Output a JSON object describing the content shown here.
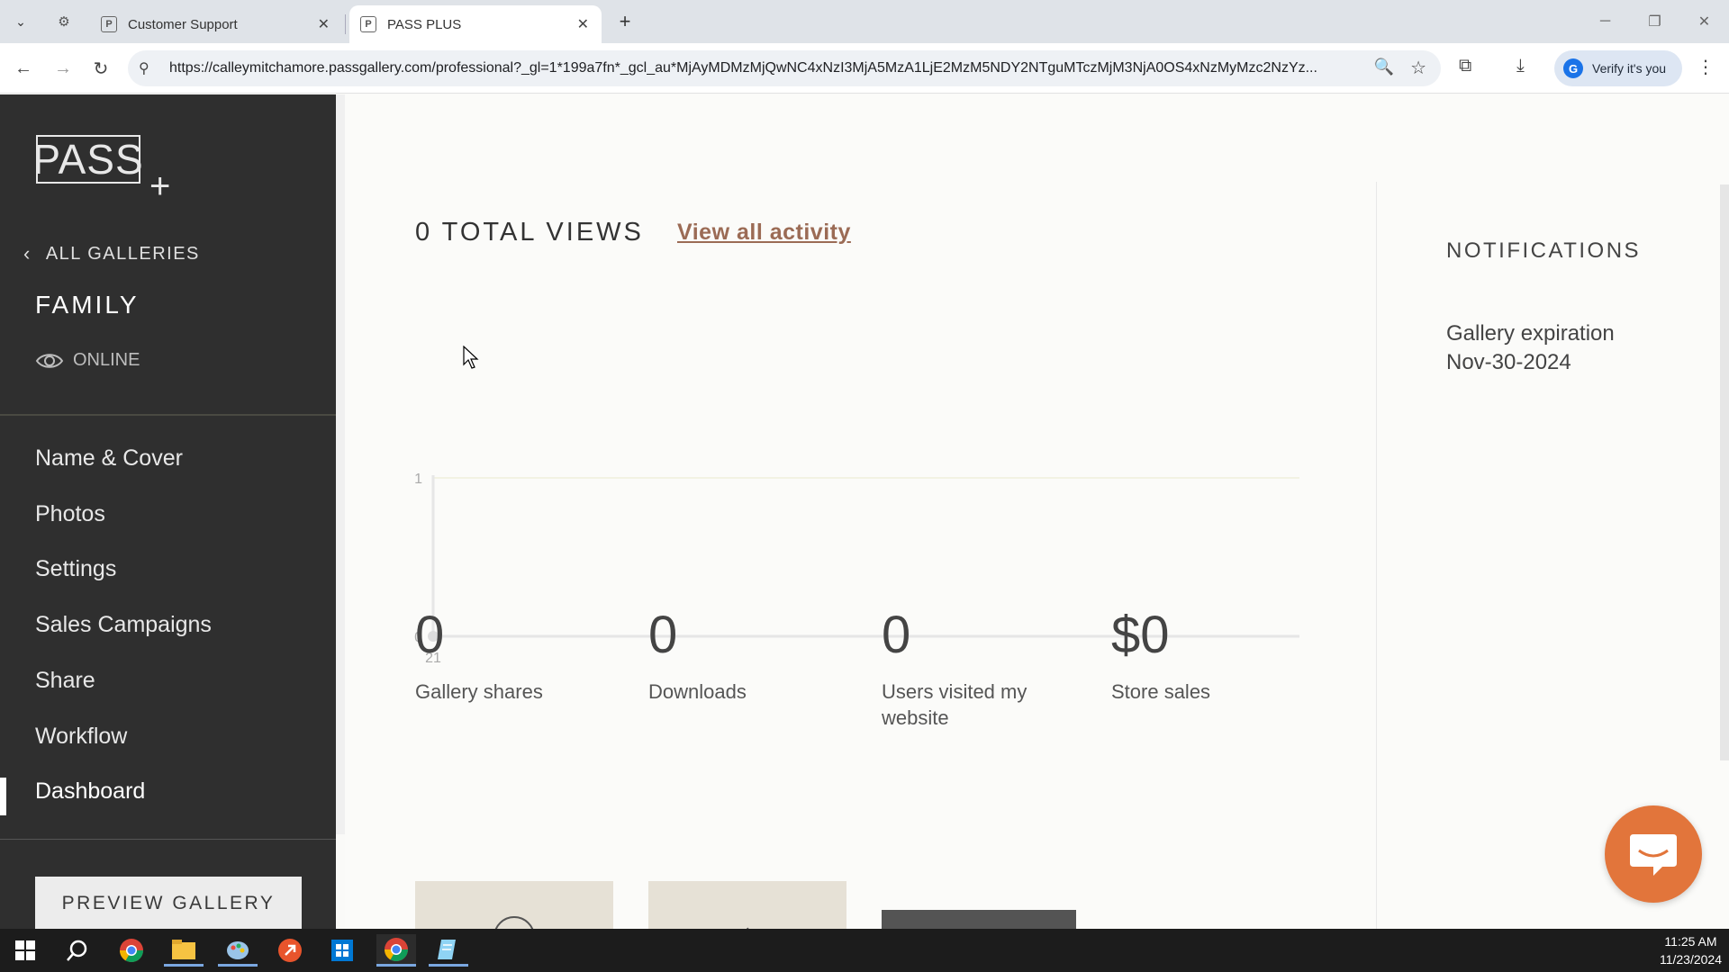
{
  "browser": {
    "tabs": [
      {
        "label": "Customer Support",
        "favicon": "P"
      },
      {
        "label": "PASS PLUS",
        "favicon": "P"
      }
    ],
    "url": "https://calleymitchamore.passgallery.com/professional?_gl=1*199a7fn*_gcl_au*MjAyMDMzMjQwNC4xNzI3MjA5MzA1LjE2MzM5NDY2NTguMTczMjM3NjA0OS4xNzMyMzc2NzYz...",
    "profile_label": "Verify it's you"
  },
  "sidebar": {
    "logo": "PASS",
    "logo_plus": "+",
    "back_label": "ALL GALLERIES",
    "gallery_name": "FAMILY",
    "status": "ONLINE",
    "nav": [
      {
        "label": "Name & Cover"
      },
      {
        "label": "Photos"
      },
      {
        "label": "Settings"
      },
      {
        "label": "Sales Campaigns"
      },
      {
        "label": "Share"
      },
      {
        "label": "Workflow"
      },
      {
        "label": "Dashboard",
        "active": true
      }
    ],
    "preview_button": "PREVIEW GALLERY"
  },
  "main": {
    "total_views": "0 TOTAL VIEWS",
    "view_all_activity": "View all activity",
    "stats": [
      {
        "value": "0",
        "label": "Gallery shares"
      },
      {
        "value": "0",
        "label": "Downloads"
      },
      {
        "value": "0",
        "label": "Users visited my website"
      },
      {
        "value": "$0",
        "label": "Store sales"
      }
    ]
  },
  "notifications": {
    "title": "NOTIFICATIONS",
    "line1": "Gallery expiration",
    "line2": "Nov-30-2024"
  },
  "chart_data": {
    "type": "line",
    "x": [
      "21"
    ],
    "values": [
      0
    ],
    "ylim": [
      0,
      1
    ],
    "yticks": [
      "0",
      "1"
    ],
    "grid": true
  },
  "taskbar": {
    "time": "11:25 AM",
    "date": "11/23/2024"
  },
  "colors": {
    "sidebar_bg": "#2f2f2f",
    "link": "#9b6b55",
    "chat_button": "#e2753b"
  }
}
